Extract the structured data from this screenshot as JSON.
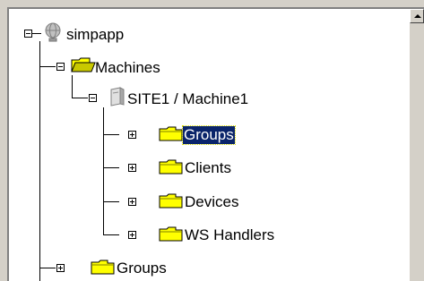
{
  "tree": {
    "root": {
      "label": "simpapp",
      "icon": "globe-icon"
    },
    "machines": {
      "label": "Machines",
      "icon": "open-folder-icon"
    },
    "machine1": {
      "label": "SITE1 / Machine1",
      "icon": "computer-icon"
    },
    "groups_child": {
      "label": "Groups",
      "icon": "folder-icon",
      "selected": true
    },
    "clients": {
      "label": "Clients",
      "icon": "folder-icon"
    },
    "devices": {
      "label": "Devices",
      "icon": "folder-icon"
    },
    "ws_handlers": {
      "label": "WS Handlers",
      "icon": "folder-icon"
    },
    "groups_root": {
      "label": "Groups",
      "icon": "folder-icon"
    }
  },
  "colors": {
    "selection": "#0a246a",
    "folder": "#ffff00",
    "panel": "#d4d0c8"
  }
}
